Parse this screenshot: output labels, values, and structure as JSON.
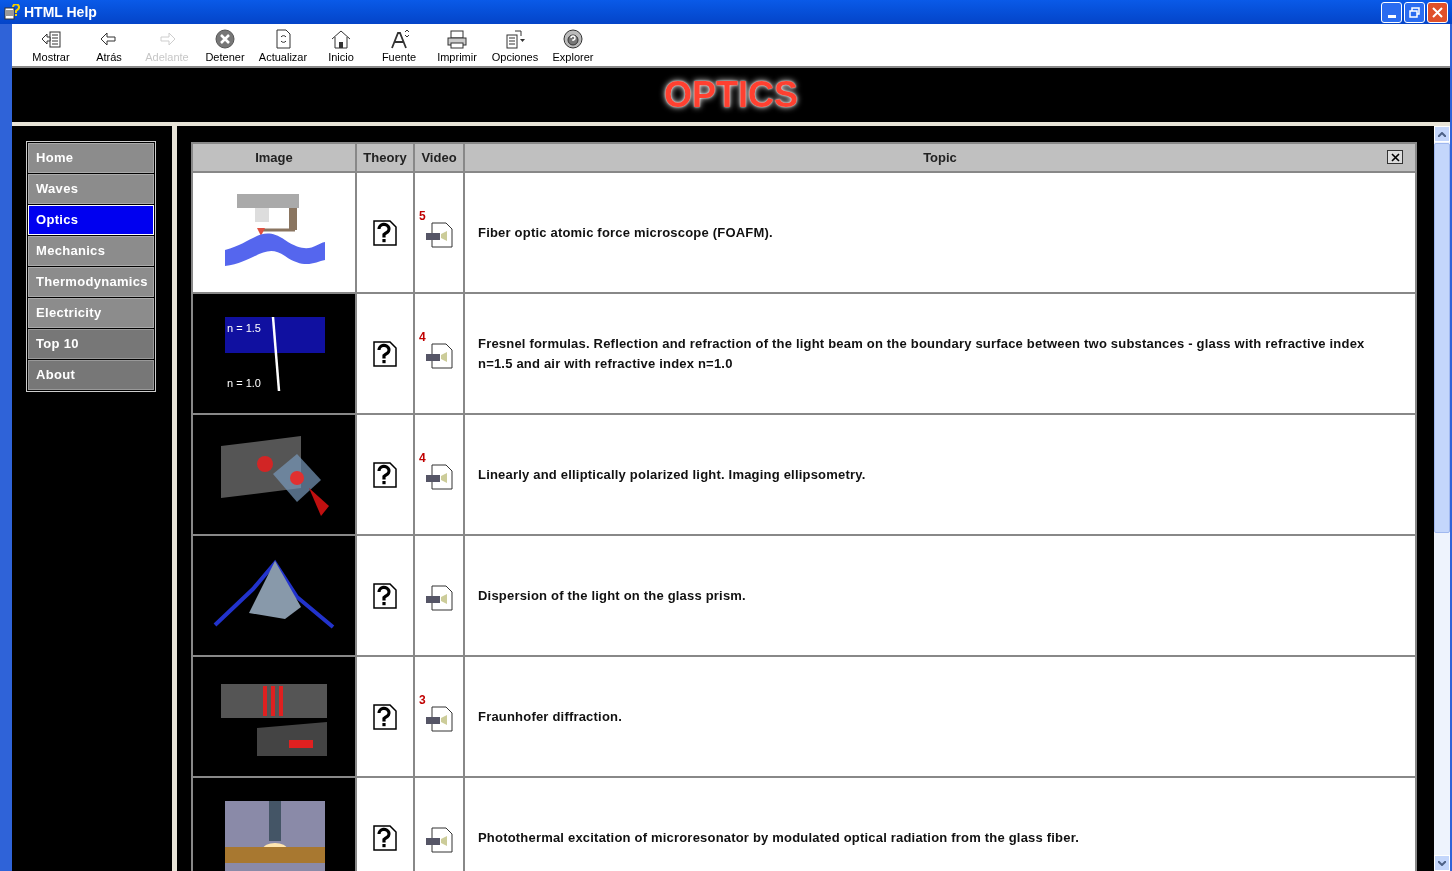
{
  "window": {
    "title": "HTML Help"
  },
  "toolbar": [
    {
      "label": "Mostrar",
      "disabled": false
    },
    {
      "label": "Atrás",
      "disabled": false
    },
    {
      "label": "Adelante",
      "disabled": true
    },
    {
      "label": "Detener",
      "disabled": false
    },
    {
      "label": "Actualizar",
      "disabled": false
    },
    {
      "label": "Inicio",
      "disabled": false
    },
    {
      "label": "Fuente",
      "disabled": false
    },
    {
      "label": "Imprimir",
      "disabled": false
    },
    {
      "label": "Opciones",
      "disabled": false
    },
    {
      "label": "Explorer",
      "disabled": false
    }
  ],
  "banner": {
    "title": "OPTICS"
  },
  "sidebar": {
    "items": [
      {
        "label": "Home",
        "selected": false
      },
      {
        "label": "Waves",
        "selected": false
      },
      {
        "label": "Optics",
        "selected": true
      },
      {
        "label": "Mechanics",
        "selected": false
      },
      {
        "label": "Thermodynamics",
        "selected": false
      },
      {
        "label": "Electricity",
        "selected": false
      },
      {
        "label": "Top 10",
        "selected": false
      },
      {
        "label": "About",
        "selected": false
      }
    ]
  },
  "table": {
    "columns": [
      "Image",
      "Theory",
      "Video",
      "Topic"
    ],
    "rows": [
      {
        "kind": "afm",
        "video_count": "5",
        "topic": "Fiber optic atomic force microscope (FOAFM)."
      },
      {
        "kind": "fresnel",
        "image_labels": [
          "n = 1.5",
          "n = 1.0"
        ],
        "video_count": "4",
        "topic": "Fresnel formulas. Reflection and refraction of the light beam on the boundary surface between two substances - glass with refractive index n=1.5 and air with refractive index n=1.0"
      },
      {
        "kind": "polarization",
        "video_count": "4",
        "topic": "Linearly and elliptically polarized light. Imaging ellipsometry."
      },
      {
        "kind": "prism",
        "topic": "Dispersion of the light on the glass prism."
      },
      {
        "kind": "diffraction",
        "video_count": "3",
        "topic": "Fraunhofer diffraction."
      },
      {
        "kind": "fiber",
        "topic": "Photothermal excitation of microresonator by modulated optical radiation from the glass fiber."
      }
    ]
  }
}
